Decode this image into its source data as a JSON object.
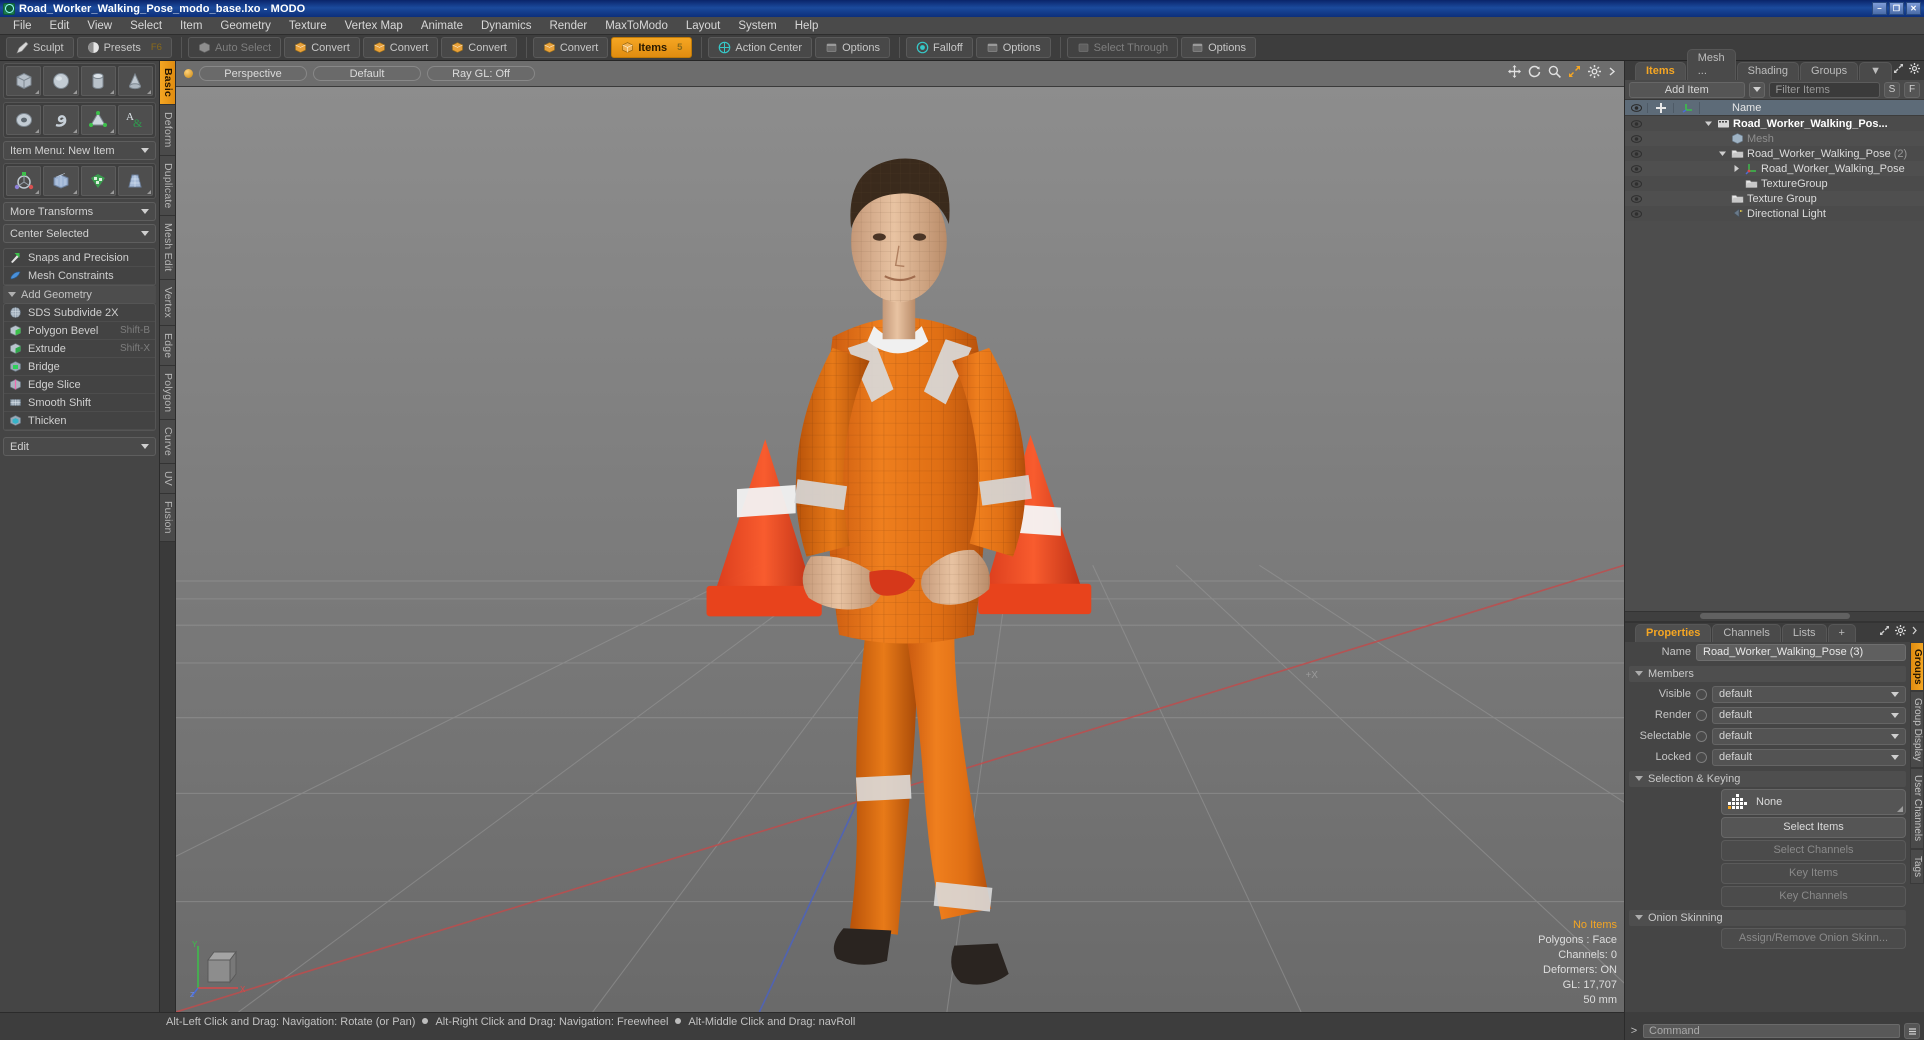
{
  "window": {
    "title": "Road_Worker_Walking_Pose_modo_base.lxo - MODO",
    "minimize": "–",
    "maximize": "❐",
    "close": "✕"
  },
  "menubar": {
    "items": [
      "File",
      "Edit",
      "View",
      "Select",
      "Item",
      "Geometry",
      "Texture",
      "Vertex Map",
      "Animate",
      "Dynamics",
      "Render",
      "MaxToModo",
      "Layout",
      "System",
      "Help"
    ]
  },
  "toolbar": {
    "groups": [
      {
        "buttons": [
          {
            "label": "Sculpt",
            "icon": "sculpt-icon",
            "state": "normal",
            "shortcut": ""
          },
          {
            "label": "Presets",
            "icon": "presets-icon",
            "state": "normal",
            "shortcut": "F6"
          }
        ]
      },
      {
        "buttons": [
          {
            "label": "Auto Select",
            "icon": "cube-grey-icon",
            "state": "dim",
            "shortcut": ""
          },
          {
            "label": "Convert",
            "icon": "cube-yellow-icon",
            "state": "normal",
            "shortcut": ""
          },
          {
            "label": "Convert",
            "icon": "cube-yellow-icon",
            "state": "normal",
            "shortcut": ""
          },
          {
            "label": "Convert",
            "icon": "cube-yellow-icon",
            "state": "normal",
            "shortcut": ""
          }
        ]
      },
      {
        "buttons": [
          {
            "label": "Convert",
            "icon": "cube-yellow-icon",
            "state": "normal",
            "shortcut": ""
          },
          {
            "label": "Items",
            "icon": "items-cube-icon",
            "state": "active",
            "shortcut": "5"
          }
        ]
      },
      {
        "buttons": [
          {
            "label": "Action Center",
            "icon": "action-center-icon",
            "state": "normal",
            "shortcut": ""
          },
          {
            "label": "Options",
            "icon": "options-icon",
            "state": "normal",
            "shortcut": ""
          }
        ]
      },
      {
        "buttons": [
          {
            "label": "Falloff",
            "icon": "falloff-icon",
            "state": "normal",
            "shortcut": ""
          },
          {
            "label": "Options",
            "icon": "options-icon",
            "state": "normal",
            "shortcut": ""
          }
        ]
      },
      {
        "buttons": [
          {
            "label": "Select Through",
            "icon": "select-through-icon",
            "state": "dim",
            "shortcut": ""
          },
          {
            "label": "Options",
            "icon": "options-icon",
            "state": "normal",
            "shortcut": ""
          }
        ]
      }
    ]
  },
  "left_panel": {
    "primitive_rows": [
      {
        "icons": [
          "cube-icon",
          "sphere-icon",
          "cylinder-icon",
          "cone-icon"
        ]
      },
      {
        "icons": [
          "torus-icon",
          "spiral-icon",
          "triangle-verts-icon",
          "text-tool-icon"
        ]
      }
    ],
    "item_menu": "Item Menu: New Item",
    "transform_rows": [
      {
        "icons": [
          "transform-gizmo-icon",
          "mesh-grid-icon",
          "uv-checker-icon",
          "taper-icon"
        ]
      }
    ],
    "more_transforms": "More Transforms",
    "center_selected": "Center Selected",
    "tool_items": [
      {
        "label": "Snaps and Precision",
        "icon": "snap-arrow-icon",
        "shortcut": ""
      },
      {
        "label": "Mesh Constraints",
        "icon": "constraint-icon",
        "shortcut": ""
      }
    ],
    "add_geometry_header": "Add Geometry",
    "geometry_items": [
      {
        "label": "SDS Subdivide 2X",
        "icon": "sds-sphere-icon",
        "shortcut": ""
      },
      {
        "label": "Polygon Bevel",
        "icon": "bevel-cube-icon",
        "shortcut": "Shift-B"
      },
      {
        "label": "Extrude",
        "icon": "extrude-cube-icon",
        "shortcut": "Shift-X"
      },
      {
        "label": "Bridge",
        "icon": "bridge-icon",
        "shortcut": ""
      },
      {
        "label": "Edge Slice",
        "icon": "edge-slice-icon",
        "shortcut": ""
      },
      {
        "label": "Smooth Shift",
        "icon": "smooth-shift-icon",
        "shortcut": ""
      },
      {
        "label": "Thicken",
        "icon": "thicken-icon",
        "shortcut": ""
      }
    ],
    "edit_dropdown": "Edit"
  },
  "vertical_tabs": {
    "items": [
      "Basic",
      "Deform",
      "Duplicate",
      "Mesh Edit",
      "Vertex",
      "Edge",
      "Polygon",
      "Curve",
      "UV",
      "Fusion"
    ],
    "active": "Basic"
  },
  "viewport": {
    "header": {
      "view_mode": "Perspective",
      "shading": "Default",
      "ray_gl": "Ray GL: Off",
      "tools": [
        "move-view-icon",
        "rotate-view-icon",
        "zoom-view-icon",
        "fit-view-icon",
        "settings-icon",
        "menu-arrow-icon"
      ]
    },
    "stats": {
      "selection": "No Items",
      "polygons": "Polygons : Face",
      "channels": "Channels: 0",
      "deformers": "Deformers: ON",
      "gl": "GL: 17,707",
      "scale": "50 mm"
    },
    "axis": {
      "y": "Y",
      "x": "X",
      "z": "Z"
    },
    "center_marker": "+X"
  },
  "items_panel": {
    "tabs": [
      {
        "label": "Items",
        "active": true
      },
      {
        "label": "Mesh ...",
        "active": false
      },
      {
        "label": "Shading",
        "active": false
      },
      {
        "label": "Groups",
        "active": false
      }
    ],
    "tab_overflow": "▼",
    "add_item": "Add Item",
    "filter_placeholder": "Filter Items",
    "filter_s": "S",
    "filter_f": "F",
    "columns": [
      "eye-column",
      "lock-column",
      "axis-column",
      "Name"
    ],
    "rows": [
      {
        "name": "Road_Worker_Walking_Pos...",
        "icon": "scene-icon",
        "indent": 0,
        "bold": true,
        "dim": false,
        "count": "",
        "expander": "down"
      },
      {
        "name": "Mesh",
        "icon": "mesh-cube-icon",
        "indent": 1,
        "bold": false,
        "dim": true,
        "count": "",
        "expander": "none"
      },
      {
        "name": "Road_Worker_Walking_Pose",
        "icon": "folder-icon",
        "indent": 1,
        "bold": false,
        "dim": false,
        "count": "(2)",
        "expander": "down"
      },
      {
        "name": "Road_Worker_Walking_Pose",
        "icon": "locator-icon",
        "indent": 2,
        "bold": false,
        "dim": false,
        "count": "",
        "expander": "right"
      },
      {
        "name": "TextureGroup",
        "icon": "folder-icon",
        "indent": 2,
        "bold": false,
        "dim": false,
        "count": "",
        "expander": "none"
      },
      {
        "name": "Texture Group",
        "icon": "folder-icon",
        "indent": 1,
        "bold": false,
        "dim": false,
        "count": "",
        "expander": "none"
      },
      {
        "name": "Directional Light",
        "icon": "light-icon",
        "indent": 1,
        "bold": false,
        "dim": false,
        "count": "",
        "expander": "none"
      }
    ]
  },
  "properties_panel": {
    "tabs": [
      {
        "label": "Properties",
        "active": true
      },
      {
        "label": "Channels",
        "active": false
      },
      {
        "label": "Lists",
        "active": false
      },
      {
        "label": "+",
        "active": false
      }
    ],
    "name_label": "Name",
    "name_value": "Road_Worker_Walking_Pose (3)",
    "members_header": "Members",
    "member_rows": [
      {
        "label": "Visible",
        "value": "default"
      },
      {
        "label": "Render",
        "value": "default"
      },
      {
        "label": "Selectable",
        "value": "default"
      },
      {
        "label": "Locked",
        "value": "default"
      }
    ],
    "selection_header": "Selection & Keying",
    "selection_combo": "None",
    "selection_buttons": [
      {
        "label": "Select Items",
        "enabled": true
      },
      {
        "label": "Select Channels",
        "enabled": false
      },
      {
        "label": "Key Items",
        "enabled": false
      },
      {
        "label": "Key Channels",
        "enabled": false
      }
    ],
    "onion_header": "Onion Skinning",
    "onion_button": "Assign/Remove Onion Skinn...",
    "side_tabs": [
      {
        "label": "Groups",
        "active": true
      },
      {
        "label": "Group Display",
        "active": false
      },
      {
        "label": "User Channels",
        "active": false
      },
      {
        "label": "Tags",
        "active": false
      }
    ]
  },
  "statusbar": {
    "hints": [
      "Alt-Left Click and Drag: Navigation: Rotate (or Pan)",
      "Alt-Right Click and Drag: Navigation: Freewheel",
      "Alt-Middle Click and Drag: navRoll"
    ],
    "command_placeholder": "Command",
    "command_arrow": ">"
  },
  "colors": {
    "accent": "#f5a623",
    "titlebar": "#1b4a9c",
    "panel": "#454545",
    "model_orange": "#e8731a",
    "model_reflective": "#cfcfcf"
  }
}
